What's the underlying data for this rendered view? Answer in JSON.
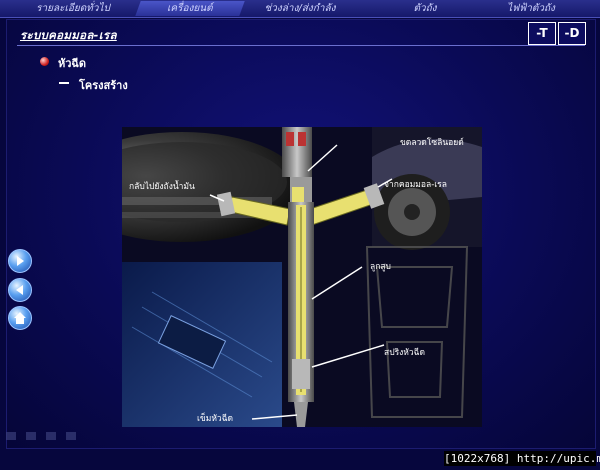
{
  "tabs": [
    {
      "label": "รายละเอียดทั่วไป"
    },
    {
      "label": "เครื่องยนต์",
      "active": true
    },
    {
      "label": "ช่วงล่าง/ส่งกำลัง"
    },
    {
      "label": "ตัวถัง"
    },
    {
      "label": "ไฟฟ้าตัวถัง"
    }
  ],
  "header": {
    "title": "ระบบคอมมอล-เรล",
    "btn_t": "-T",
    "btn_d": "-D"
  },
  "content": {
    "bullet1": "หัวฉีด",
    "bullet2": "โครงสร้าง"
  },
  "labels": {
    "solenoid": "ขดลวดโซลินอยด์",
    "return": "กลับไปยังถังน้ำมัน",
    "from_rail": "จากคอมมอล-เรล",
    "plunger": "ลูกสูบ",
    "spring": "สปริงหัวฉีด",
    "needle": "เข็มหัวฉีด"
  },
  "nav": {
    "next_icon": "arrow-right-icon",
    "prev_icon": "arrow-left-icon",
    "home_icon": "home-icon"
  },
  "footer": "[1022x768] http://upic.me/",
  "colors": {
    "background": "#06063d",
    "panel": "#0a0a55",
    "tab_bar": "#1e2278",
    "tab_active": "#3a44b8",
    "injector": "#e8e070"
  }
}
